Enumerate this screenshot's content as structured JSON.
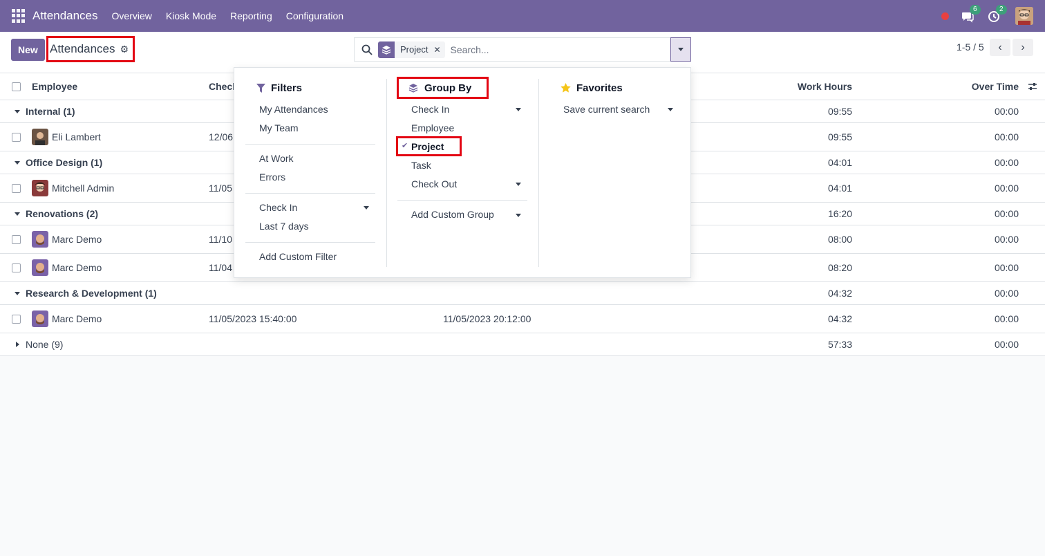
{
  "navbar": {
    "app_title": "Attendances",
    "menu": [
      "Overview",
      "Kiosk Mode",
      "Reporting",
      "Configuration"
    ],
    "messages_count": "6",
    "activities_count": "2",
    "bg_color": "#71639e"
  },
  "control": {
    "new_label": "New",
    "title": "Attendances",
    "facet_label": "Project",
    "search_placeholder": "Search...",
    "pager_text": "1-5 / 5"
  },
  "list": {
    "columns": {
      "employee": "Employee",
      "check_in": "Check In",
      "work_hours": "Work Hours",
      "over_time": "Over Time"
    },
    "rows": [
      {
        "kind": "group",
        "label": "Internal (1)",
        "work_hours": "09:55",
        "over_time": "00:00"
      },
      {
        "kind": "record",
        "employee": "Eli Lambert",
        "check_in": "12/06",
        "check_out": "",
        "work_hours": "09:55",
        "over_time": "00:00"
      },
      {
        "kind": "group",
        "label": "Office Design (1)",
        "work_hours": "04:01",
        "over_time": "00:00"
      },
      {
        "kind": "record",
        "employee": "Mitchell Admin",
        "check_in": "11/05",
        "check_out": "",
        "work_hours": "04:01",
        "over_time": "00:00"
      },
      {
        "kind": "group",
        "label": "Renovations (2)",
        "work_hours": "16:20",
        "over_time": "00:00"
      },
      {
        "kind": "record",
        "employee": "Marc Demo",
        "check_in": "11/10",
        "check_out": "",
        "work_hours": "08:00",
        "over_time": "00:00"
      },
      {
        "kind": "record",
        "employee": "Marc Demo",
        "check_in": "11/04",
        "check_out": "",
        "work_hours": "08:20",
        "over_time": "00:00"
      },
      {
        "kind": "group",
        "label": "Research & Development (1)",
        "work_hours": "04:32",
        "over_time": "00:00"
      },
      {
        "kind": "record",
        "employee": "Marc Demo",
        "check_in": "11/05/2023 15:40:00",
        "check_out": "11/05/2023 20:12:00",
        "work_hours": "04:32",
        "over_time": "00:00"
      },
      {
        "kind": "group_collapsed",
        "label": "None (9)",
        "work_hours": "57:33",
        "over_time": "00:00"
      }
    ]
  },
  "dropdown": {
    "filters": {
      "title": "Filters",
      "items": [
        "My Attendances",
        "My Team",
        "At Work",
        "Errors",
        "Check In",
        "Last 7 days",
        "Add Custom Filter"
      ]
    },
    "group_by": {
      "title": "Group By",
      "items": [
        "Check In",
        "Employee",
        "Project",
        "Task",
        "Check Out",
        "Add Custom Group"
      ]
    },
    "favorites": {
      "title": "Favorites",
      "items": [
        "Save current search"
      ]
    }
  },
  "colors": {
    "accent": "#71639e",
    "highlight": "#e30613",
    "badge": "#3da07a",
    "star": "#f5c518"
  }
}
